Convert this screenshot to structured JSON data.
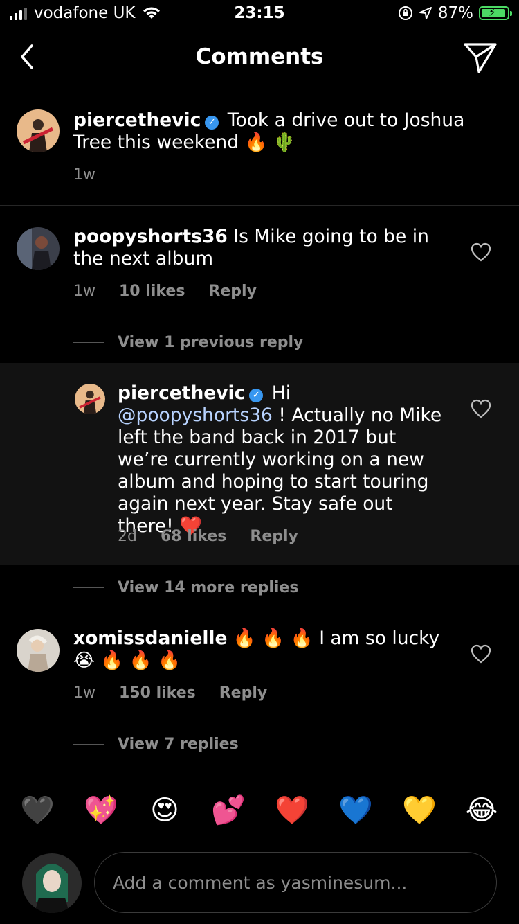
{
  "status_bar": {
    "carrier": "vodafone UK",
    "time": "23:15",
    "battery": "87%"
  },
  "nav": {
    "title": "Comments"
  },
  "caption": {
    "username": "piercethevic",
    "text": "Took a drive out to Joshua Tree this weekend",
    "emojis": "🔥 🌵",
    "time": "1w"
  },
  "comments": [
    {
      "username": "poopyshorts36",
      "text": "Is Mike going to be in the next album",
      "time": "1w",
      "likes": "10 likes",
      "reply_label": "Reply",
      "view_replies": "View 1 previous reply"
    },
    {
      "username": "xomissdanielle",
      "text_emojis_1": "🔥 🔥 🔥",
      "text": "I am so lucky",
      "text_emojis_2": "😭 🔥 🔥 🔥",
      "time": "1w",
      "likes": "150 likes",
      "reply_label": "Reply",
      "view_replies": "View 7 replies"
    }
  ],
  "reply": {
    "username": "piercethevic",
    "greeting": "Hi",
    "mention": "@poopyshorts36",
    "text": "! Actually no Mike left the band back in 2017 but we’re currently working on a new album and hoping to start touring again next year. Stay safe out there!",
    "emoji": "❤️",
    "time": "2d",
    "likes": "68 likes",
    "reply_label": "Reply",
    "view_more": "View 14 more replies"
  },
  "emoji_bar": [
    "🖤",
    "💖",
    "😍",
    "💕",
    "❤️",
    "💙",
    "💛",
    "😂"
  ],
  "composer": {
    "placeholder": "Add a comment as yasminesum..."
  },
  "colors": {
    "verified": "#3897f0",
    "mention": "#b8d3ff",
    "battery": "#4cd964",
    "muted": "#8e8e8e"
  }
}
